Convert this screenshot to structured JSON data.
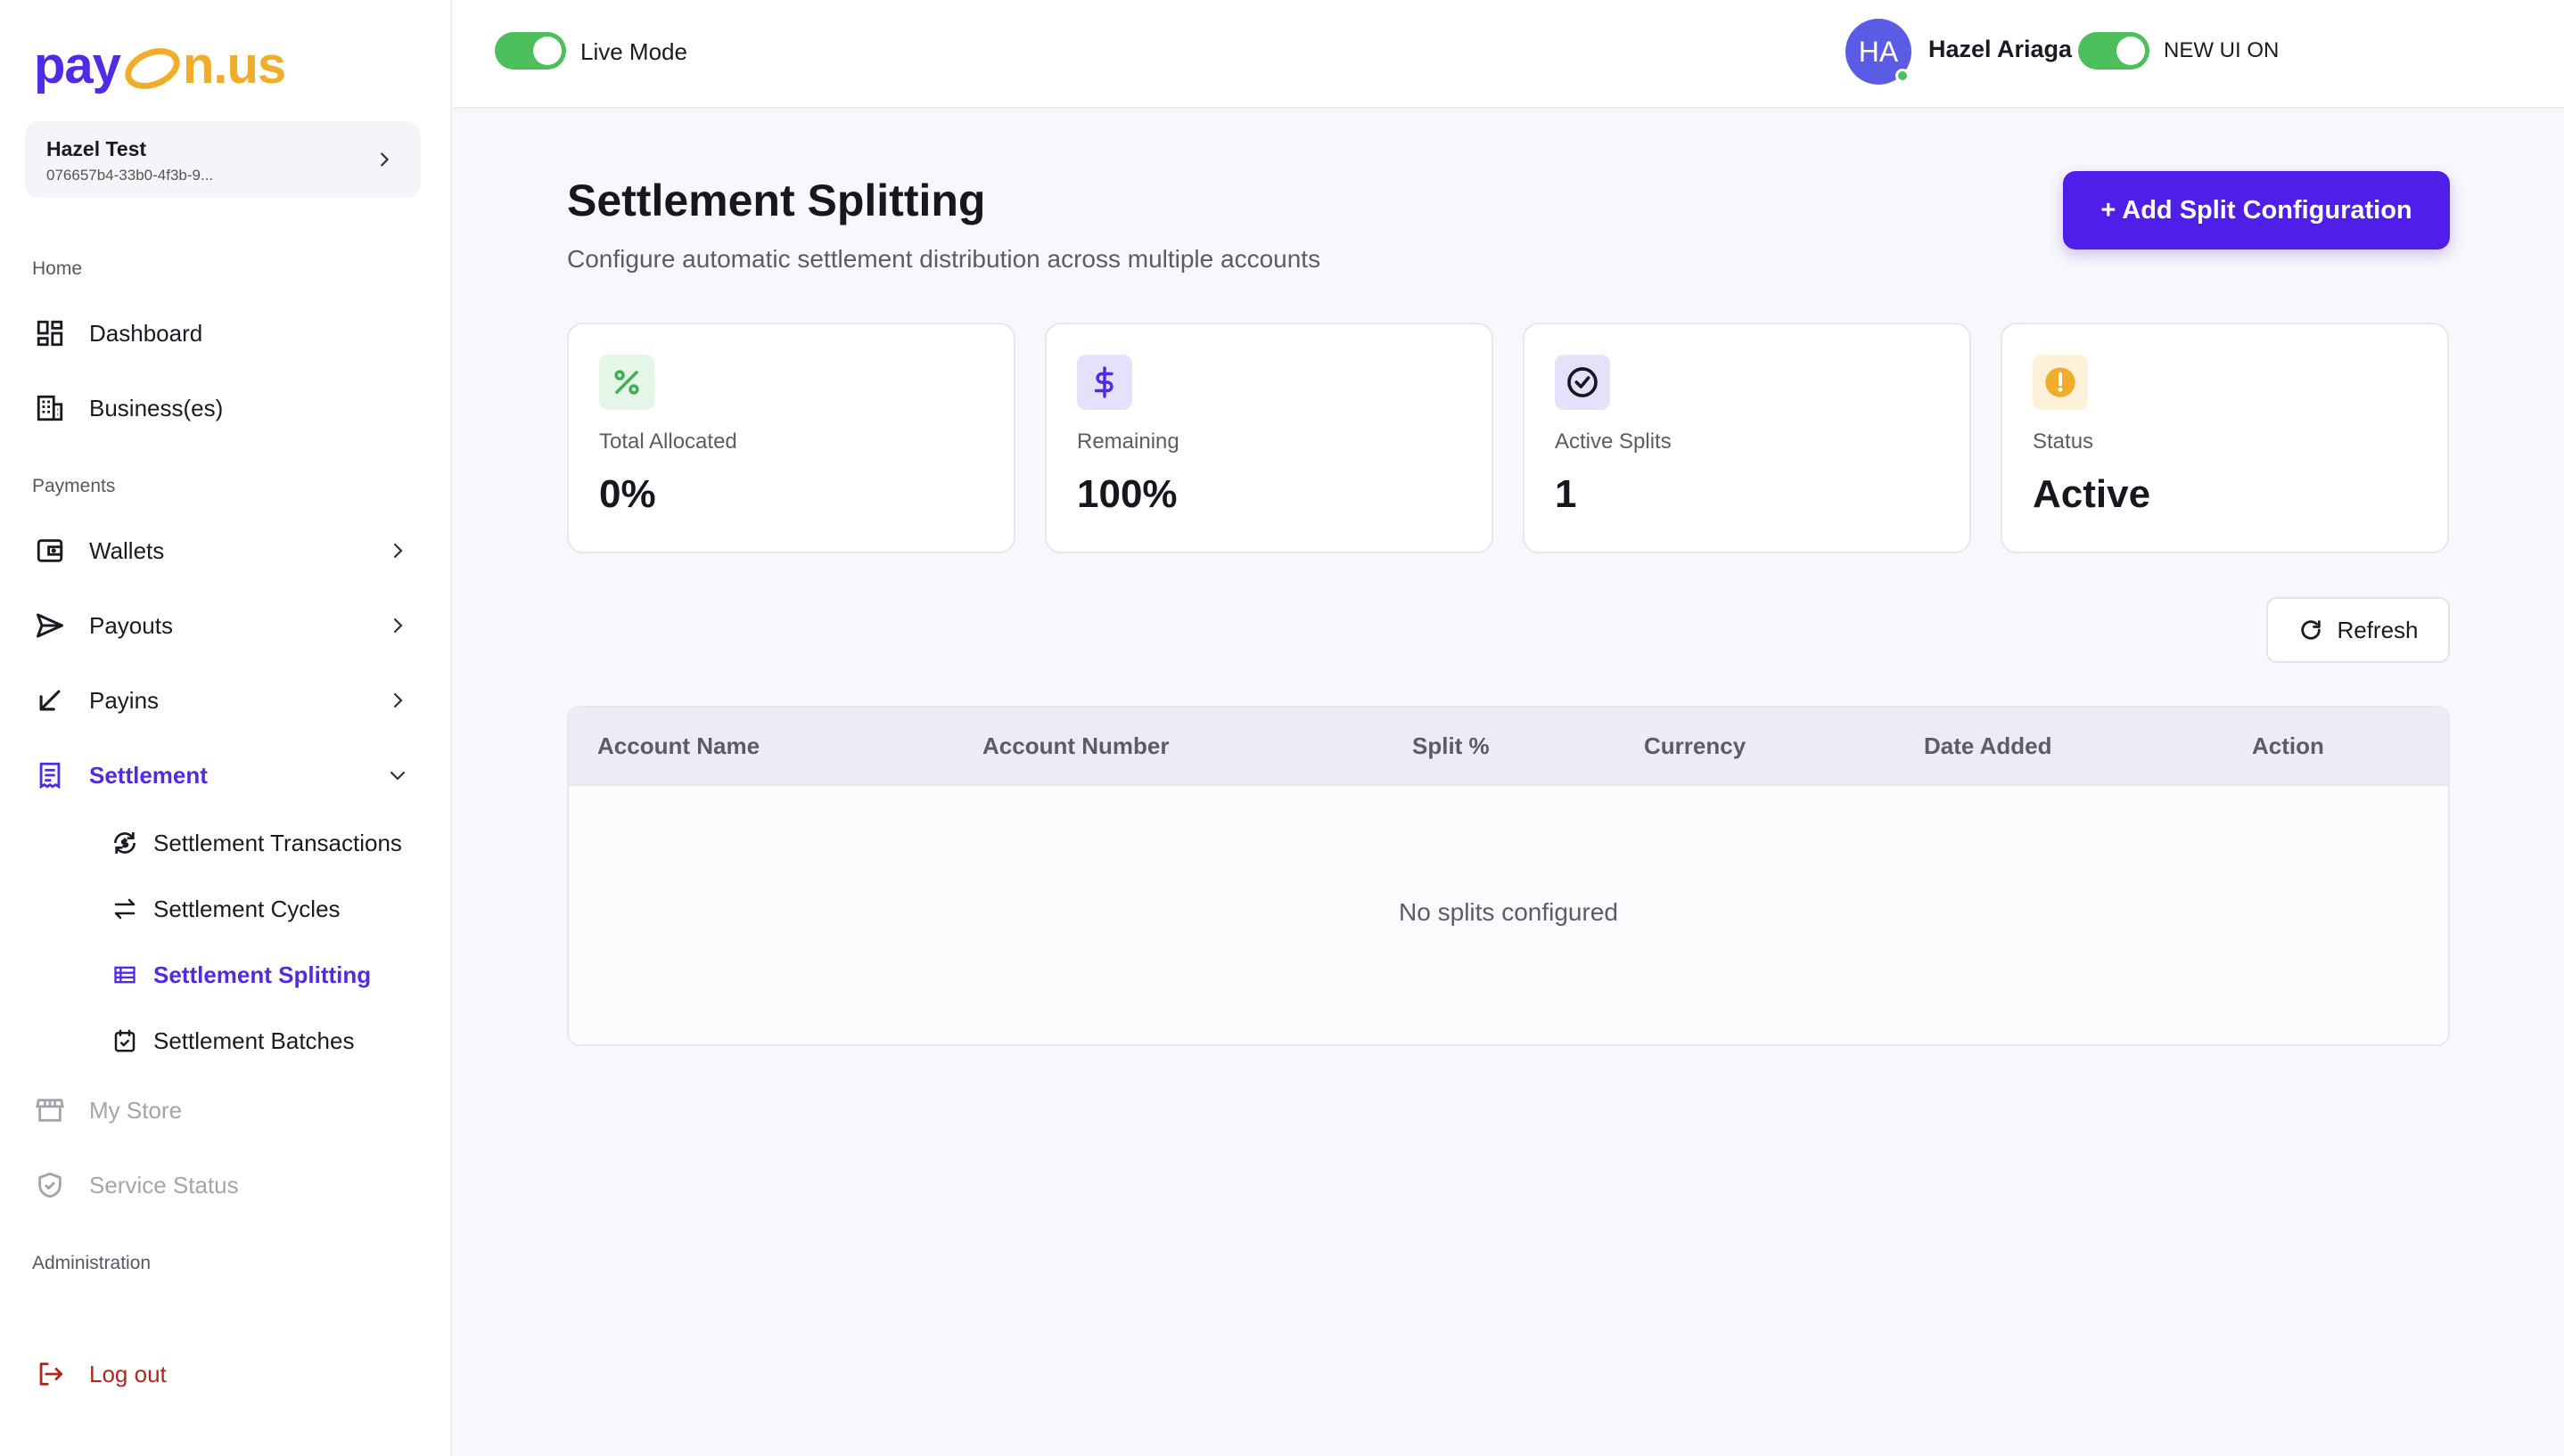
{
  "logo": {
    "part1": "pay",
    "part2": "n.us"
  },
  "business": {
    "name": "Hazel Test",
    "id": "076657b4-33b0-4f3b-9..."
  },
  "sidebar": {
    "sections": {
      "home": "Home",
      "payments": "Payments",
      "administration": "Administration"
    },
    "items": {
      "dashboard": "Dashboard",
      "businesses": "Business(es)",
      "wallets": "Wallets",
      "payouts": "Payouts",
      "payins": "Payins",
      "settlement": "Settlement",
      "my_store": "My Store",
      "service_status": "Service Status"
    },
    "sub_items": {
      "transactions": "Settlement Transactions",
      "cycles": "Settlement Cycles",
      "splitting": "Settlement Splitting",
      "batches": "Settlement Batches"
    },
    "logout": "Log out"
  },
  "topbar": {
    "live_mode": "Live Mode",
    "new_ui": "NEW UI ON",
    "avatar_initials": "HA",
    "user_name": "Hazel Ariaga"
  },
  "main": {
    "title": "Settlement Splitting",
    "subtitle": "Configure automatic settlement distribution across multiple accounts",
    "add_button": "+ Add Split Configuration",
    "stats": [
      {
        "label": "Total Allocated",
        "value": "0%"
      },
      {
        "label": "Remaining",
        "value": "100%"
      },
      {
        "label": "Active Splits",
        "value": "1"
      },
      {
        "label": "Status",
        "value": "Active"
      }
    ],
    "refresh": "Refresh",
    "table": {
      "columns": [
        "Account Name",
        "Account Number",
        "Split %",
        "Currency",
        "Date Added",
        "Action"
      ],
      "empty": "No splits configured"
    }
  },
  "colors": {
    "brand": "#4f1ee8",
    "accent": "#f0ad2c",
    "toggle_on": "#4cbf5a",
    "logout": "#b3261e"
  }
}
